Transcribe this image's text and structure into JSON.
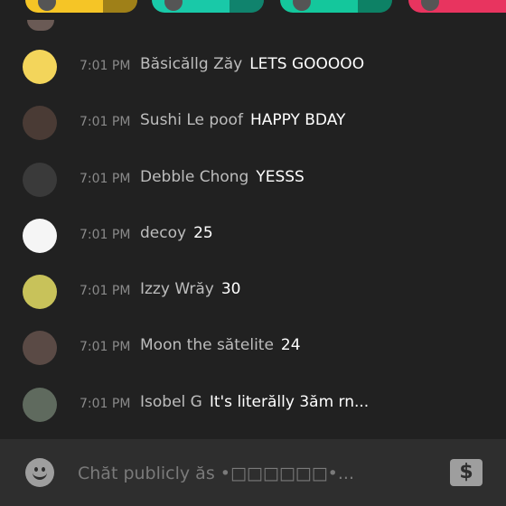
{
  "top_pills": [
    {
      "color": "#f5c526"
    },
    {
      "color": "#19c9a8"
    },
    {
      "color": "#14c79c"
    },
    {
      "color": "#e8345f"
    }
  ],
  "messages": [
    {
      "time": "7:01 PM",
      "name": "Băsicăllg Zăy",
      "text": "LETS GOOOOO",
      "avatar_color": "#f3d55b"
    },
    {
      "time": "7:01 PM",
      "name": "Sushi Le poof",
      "text": "HAPPY BDAY",
      "avatar_color": "#4a3b35"
    },
    {
      "time": "7:01 PM",
      "name": "Debble Chong",
      "text": "YESSS",
      "avatar_color": "#3a3a3a"
    },
    {
      "time": "7:01 PM",
      "name": "decoy",
      "text": "25",
      "avatar_color": "#f5f5f5"
    },
    {
      "time": "7:01 PM",
      "name": "Izzy Wrăy",
      "text": "30",
      "avatar_color": "#c8c25a"
    },
    {
      "time": "7:01 PM",
      "name": "Moon the sătelite",
      "text": "24",
      "avatar_color": "#5a4a45"
    },
    {
      "time": "7:01 PM",
      "name": "Isobel G",
      "text": "It's literălly 3ăm rn...",
      "avatar_color": "#5f6a5e"
    }
  ],
  "input": {
    "placeholder": "Chăt publicly ăs •□□□□□□•..."
  },
  "bottom": {
    "emoji_icon": "smiley-icon",
    "dollar_icon": "dollar-icon",
    "dollar_glyph": "$"
  }
}
